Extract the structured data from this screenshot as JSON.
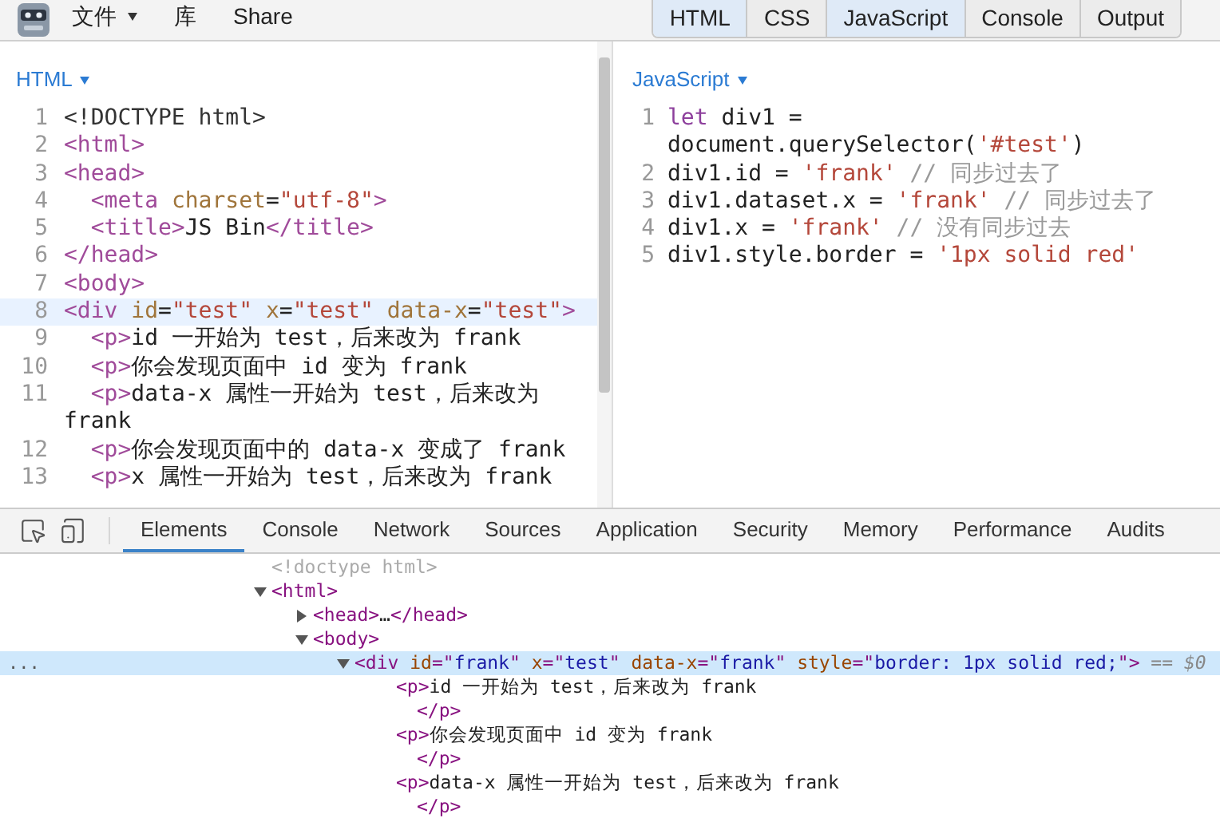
{
  "menu": [
    {
      "label": "文件",
      "has_caret": true
    },
    {
      "label": "库",
      "has_caret": false
    },
    {
      "label": "Share",
      "has_caret": false
    }
  ],
  "panel_tabs": [
    {
      "label": "HTML",
      "selected": true
    },
    {
      "label": "CSS",
      "selected": false
    },
    {
      "label": "JavaScript",
      "selected": true
    },
    {
      "label": "Console",
      "selected": false
    },
    {
      "label": "Output",
      "selected": false
    }
  ],
  "editors": [
    {
      "title": "HTML",
      "lines": [
        {
          "number": "1",
          "highlighted": false,
          "segments": [
            {
              "text": "<!DOCTYPE html>",
              "kind": "meta"
            }
          ]
        },
        {
          "number": "2",
          "highlighted": false,
          "segments": [
            {
              "text": "<html>",
              "kind": "tag"
            }
          ]
        },
        {
          "number": "3",
          "highlighted": false,
          "segments": [
            {
              "text": "<head>",
              "kind": "tag"
            }
          ]
        },
        {
          "number": "4",
          "highlighted": false,
          "segments": [
            {
              "text": "  <meta ",
              "kind": "tag"
            },
            {
              "text": "charset",
              "kind": "attr"
            },
            {
              "text": "=",
              "kind": "text"
            },
            {
              "text": "\"utf-8\"",
              "kind": "string"
            },
            {
              "text": ">",
              "kind": "tag"
            }
          ]
        },
        {
          "number": "5",
          "highlighted": false,
          "segments": [
            {
              "text": "  <title>",
              "kind": "tag"
            },
            {
              "text": "JS Bin",
              "kind": "text"
            },
            {
              "text": "</title>",
              "kind": "tag"
            }
          ]
        },
        {
          "number": "6",
          "highlighted": false,
          "segments": [
            {
              "text": "</head>",
              "kind": "tag"
            }
          ]
        },
        {
          "number": "7",
          "highlighted": false,
          "segments": [
            {
              "text": "<body>",
              "kind": "tag"
            }
          ]
        },
        {
          "number": "8",
          "highlighted": true,
          "segments": [
            {
              "text": "<div ",
              "kind": "tag"
            },
            {
              "text": "id",
              "kind": "attr"
            },
            {
              "text": "=",
              "kind": "text"
            },
            {
              "text": "\"test\"",
              "kind": "string"
            },
            {
              "text": " x",
              "kind": "attr"
            },
            {
              "text": "=",
              "kind": "text"
            },
            {
              "text": "\"test\"",
              "kind": "string"
            },
            {
              "text": " data-x",
              "kind": "attr"
            },
            {
              "text": "=",
              "kind": "text"
            },
            {
              "text": "\"test\"",
              "kind": "string"
            },
            {
              "text": ">",
              "kind": "tag"
            }
          ]
        },
        {
          "number": "9",
          "highlighted": false,
          "segments": [
            {
              "text": "  <p>",
              "kind": "tag"
            },
            {
              "text": "id 一开始为 test，后来改为 frank",
              "kind": "text"
            }
          ]
        },
        {
          "number": "10",
          "highlighted": false,
          "segments": [
            {
              "text": "  <p>",
              "kind": "tag"
            },
            {
              "text": "你会发现页面中 id 变为 frank",
              "kind": "text"
            }
          ]
        },
        {
          "number": "11",
          "highlighted": false,
          "segments": [
            {
              "text": "  <p>",
              "kind": "tag"
            },
            {
              "text": "data-x 属性一开始为 test，后来改为 frank",
              "kind": "text"
            }
          ]
        },
        {
          "number": "12",
          "highlighted": false,
          "segments": [
            {
              "text": "  <p>",
              "kind": "tag"
            },
            {
              "text": "你会发现页面中的 data-x 变成了 frank",
              "kind": "text"
            }
          ]
        },
        {
          "number": "13",
          "highlighted": false,
          "segments": [
            {
              "text": "  <p>",
              "kind": "tag"
            },
            {
              "text": "x 属性一开始为 test，后来改为 frank",
              "kind": "text"
            }
          ]
        }
      ]
    },
    {
      "title": "JavaScript",
      "lines": [
        {
          "number": "1",
          "highlighted": false,
          "segments": [
            {
              "text": "let",
              "kind": "keyword"
            },
            {
              "text": " div1 = document.querySelector(",
              "kind": "text"
            },
            {
              "text": "'#test'",
              "kind": "string"
            },
            {
              "text": ")",
              "kind": "text"
            }
          ]
        },
        {
          "number": "2",
          "highlighted": false,
          "segments": [
            {
              "text": "div1.id = ",
              "kind": "text"
            },
            {
              "text": "'frank'",
              "kind": "string"
            },
            {
              "text": " // 同步过去了",
              "kind": "comment"
            }
          ]
        },
        {
          "number": "3",
          "highlighted": false,
          "segments": [
            {
              "text": "div1.dataset.x = ",
              "kind": "text"
            },
            {
              "text": "'frank'",
              "kind": "string"
            },
            {
              "text": " // 同步过去了",
              "kind": "comment"
            }
          ]
        },
        {
          "number": "4",
          "highlighted": false,
          "segments": [
            {
              "text": "div1.x = ",
              "kind": "text"
            },
            {
              "text": "'frank'",
              "kind": "string"
            },
            {
              "text": " // 没有同步过去",
              "kind": "comment"
            }
          ]
        },
        {
          "number": "5",
          "highlighted": false,
          "segments": [
            {
              "text": "div1.style.border = ",
              "kind": "text"
            },
            {
              "text": "'1px solid red'",
              "kind": "string"
            }
          ]
        }
      ]
    }
  ],
  "devtools_tabs": [
    {
      "label": "Elements",
      "selected": true
    },
    {
      "label": "Console",
      "selected": false
    },
    {
      "label": "Network",
      "selected": false
    },
    {
      "label": "Sources",
      "selected": false
    },
    {
      "label": "Application",
      "selected": false
    },
    {
      "label": "Security",
      "selected": false
    },
    {
      "label": "Memory",
      "selected": false
    },
    {
      "label": "Performance",
      "selected": false
    },
    {
      "label": "Audits",
      "selected": false
    }
  ],
  "dom_tree": [
    {
      "selected": false,
      "segments": [
        {
          "text": "<!doctype html>",
          "kind": "dim"
        }
      ]
    },
    {
      "selected": false,
      "expanded": true,
      "segments": [
        {
          "text": "<html>",
          "kind": "tag"
        }
      ],
      "children": [
        {
          "selected": false,
          "expanded": false,
          "segments": [
            {
              "text": "<head>",
              "kind": "tag"
            },
            {
              "text": "…",
              "kind": "text"
            },
            {
              "text": "</head>",
              "kind": "tag"
            }
          ]
        },
        {
          "selected": false,
          "expanded": true,
          "segments": [
            {
              "text": "<body>",
              "kind": "tag"
            }
          ],
          "children": [
            {
              "selected": true,
              "expanded": true,
              "actions": "...",
              "segments": [
                {
                  "text": "<div ",
                  "kind": "tag"
                },
                {
                  "text": "id",
                  "kind": "attr"
                },
                {
                  "text": "=\"",
                  "kind": "tag"
                },
                {
                  "text": "frank",
                  "kind": "value"
                },
                {
                  "text": "\" ",
                  "kind": "tag"
                },
                {
                  "text": "x",
                  "kind": "attr"
                },
                {
                  "text": "=\"",
                  "kind": "tag"
                },
                {
                  "text": "test",
                  "kind": "value"
                },
                {
                  "text": "\" ",
                  "kind": "tag"
                },
                {
                  "text": "data-x",
                  "kind": "attr"
                },
                {
                  "text": "=\"",
                  "kind": "tag"
                },
                {
                  "text": "frank",
                  "kind": "value"
                },
                {
                  "text": "\" ",
                  "kind": "tag"
                },
                {
                  "text": "style",
                  "kind": "attr"
                },
                {
                  "text": "=\"",
                  "kind": "tag"
                },
                {
                  "text": "border: 1px solid red;",
                  "kind": "value"
                },
                {
                  "text": "\">",
                  "kind": "tag"
                },
                {
                  "text": " == $0",
                  "kind": "ref"
                }
              ],
              "children": [
                {
                  "selected": false,
                  "segments": [
                    {
                      "text": "<p>",
                      "kind": "tag"
                    },
                    {
                      "text": "id 一开始为 test，后来改为 frank",
                      "kind": "text"
                    }
                  ],
                  "children": [
                    {
                      "selected": false,
                      "segments": [
                        {
                          "text": "</p>",
                          "kind": "tag"
                        }
                      ]
                    }
                  ]
                },
                {
                  "selected": false,
                  "segments": [
                    {
                      "text": "<p>",
                      "kind": "tag"
                    },
                    {
                      "text": "你会发现页面中 id 变为 frank",
                      "kind": "text"
                    }
                  ],
                  "children": [
                    {
                      "selected": false,
                      "segments": [
                        {
                          "text": "</p>",
                          "kind": "tag"
                        }
                      ]
                    }
                  ]
                },
                {
                  "selected": false,
                  "segments": [
                    {
                      "text": "<p>",
                      "kind": "tag"
                    },
                    {
                      "text": "data-x 属性一开始为 test，后来改为 frank",
                      "kind": "text"
                    }
                  ],
                  "children": [
                    {
                      "selected": false,
                      "segments": [
                        {
                          "text": "</p>",
                          "kind": "tag"
                        }
                      ]
                    }
                  ]
                }
              ]
            }
          ]
        }
      ]
    }
  ]
}
